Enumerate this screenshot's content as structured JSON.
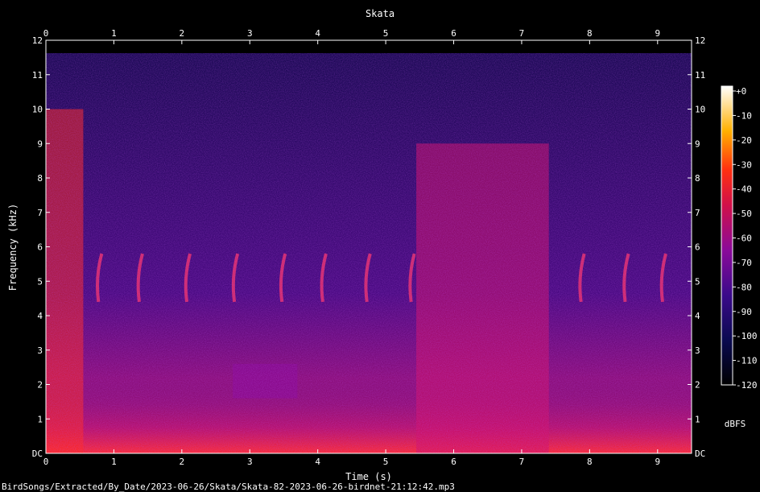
{
  "chart_data": {
    "type": "heatmap",
    "title": "Skata",
    "xlabel": "Time (s)",
    "ylabel": "Frequency (kHz)",
    "colorbar_label": "dBFS",
    "xlim": [
      0,
      9.5
    ],
    "ylim": [
      0,
      12
    ],
    "x_ticks": [
      "0",
      "1",
      "2",
      "3",
      "4",
      "5",
      "6",
      "7",
      "8",
      "9"
    ],
    "y_ticks": [
      "DC",
      "1",
      "2",
      "3",
      "4",
      "5",
      "6",
      "7",
      "8",
      "9",
      "10",
      "11",
      "12"
    ],
    "colorbar_range": [
      -120,
      0
    ],
    "colorbar_ticks": [
      "+0",
      "-10",
      "-20",
      "-30",
      "-40",
      "-50",
      "-60",
      "-70",
      "-80",
      "-90",
      "-100",
      "-110",
      "-120"
    ],
    "colormap": "sox-spectrogram",
    "grid": false,
    "energy_regions": [
      {
        "t": [
          0.0,
          0.55
        ],
        "f": [
          0,
          10
        ],
        "level": -55
      },
      {
        "t": [
          5.45,
          7.4
        ],
        "f": [
          0,
          9
        ],
        "level": -60
      },
      {
        "t": [
          2.75,
          3.7
        ],
        "f": [
          1.6,
          2.6
        ],
        "level": -75
      }
    ],
    "chirps": [
      {
        "t": 0.75,
        "f": [
          4.4,
          5.8
        ]
      },
      {
        "t": 1.35,
        "f": [
          4.4,
          5.8
        ]
      },
      {
        "t": 2.05,
        "f": [
          4.4,
          5.8
        ]
      },
      {
        "t": 2.75,
        "f": [
          4.4,
          5.8
        ]
      },
      {
        "t": 3.45,
        "f": [
          4.4,
          5.8
        ]
      },
      {
        "t": 4.05,
        "f": [
          4.4,
          5.8
        ]
      },
      {
        "t": 4.7,
        "f": [
          4.4,
          5.8
        ]
      },
      {
        "t": 5.35,
        "f": [
          4.4,
          5.8
        ]
      },
      {
        "t": 7.85,
        "f": [
          4.4,
          5.8
        ]
      },
      {
        "t": 8.5,
        "f": [
          4.4,
          5.8
        ]
      },
      {
        "t": 9.05,
        "f": [
          4.4,
          5.8
        ]
      }
    ]
  },
  "footer": {
    "filename": "BirdSongs/Extracted/By_Date/2023-06-26/Skata/Skata-82-2023-06-26-birdnet-21:12:42.mp3"
  }
}
